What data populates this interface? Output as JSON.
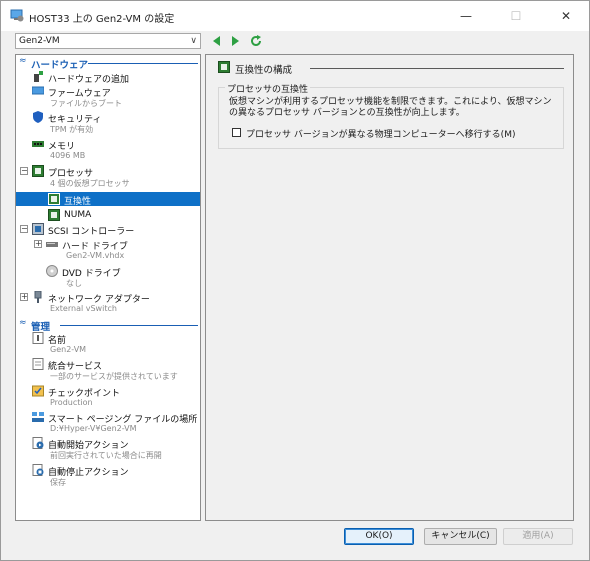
{
  "window": {
    "title": "HOST33 上の Gen2-VM の設定",
    "controls": {
      "minimize": "—",
      "maximize": "☐",
      "close": "✕"
    }
  },
  "toolbar": {
    "vm_selected": "Gen2-VM"
  },
  "sections": {
    "hardware": "ハードウェア",
    "management": "管理"
  },
  "hardware_items": [
    {
      "label": "ハードウェアの追加",
      "sub": ""
    },
    {
      "label": "ファームウェア",
      "sub": "ファイルからブート"
    },
    {
      "label": "セキュリティ",
      "sub": "TPM が有効"
    },
    {
      "label": "メモリ",
      "sub": "4096 MB"
    },
    {
      "label": "プロセッサ",
      "sub": "4 個の仮想プロセッサ"
    },
    {
      "label": "互換性",
      "sub": ""
    },
    {
      "label": "NUMA",
      "sub": ""
    },
    {
      "label": "SCSI コントローラー",
      "sub": ""
    },
    {
      "label": "ハード ドライブ",
      "sub": "Gen2-VM.vhdx"
    },
    {
      "label": "DVD ドライブ",
      "sub": "なし"
    },
    {
      "label": "ネットワーク アダプター",
      "sub": "External vSwitch"
    }
  ],
  "management_items": [
    {
      "label": "名前",
      "sub": "Gen2-VM"
    },
    {
      "label": "統合サービス",
      "sub": "一部のサービスが提供されています"
    },
    {
      "label": "チェックポイント",
      "sub": "Production"
    },
    {
      "label": "スマート ページング ファイルの場所",
      "sub": "D:¥Hyper-V¥Gen2-VM"
    },
    {
      "label": "自動開始アクション",
      "sub": "前回実行されていた場合に再開"
    },
    {
      "label": "自動停止アクション",
      "sub": "保存"
    }
  ],
  "right_pane": {
    "heading": "互換性の構成",
    "group_title": "プロセッサの互換性",
    "description": "仮想マシンが利用するプロセッサ機能を制限できます。これにより、仮想マシンの異なるプロセッサ バージョンとの互換性が向上します。",
    "checkbox_label": "プロセッサ バージョンが異なる物理コンピューターへ移行する(M)",
    "checkbox_checked": false
  },
  "buttons": {
    "ok": "OK(O)",
    "cancel": "キャンセル(C)",
    "apply": "適用(A)"
  },
  "colors": {
    "selection": "#0e70c7",
    "section_header": "#1a5fb4",
    "nav_green": "#2ea043"
  }
}
